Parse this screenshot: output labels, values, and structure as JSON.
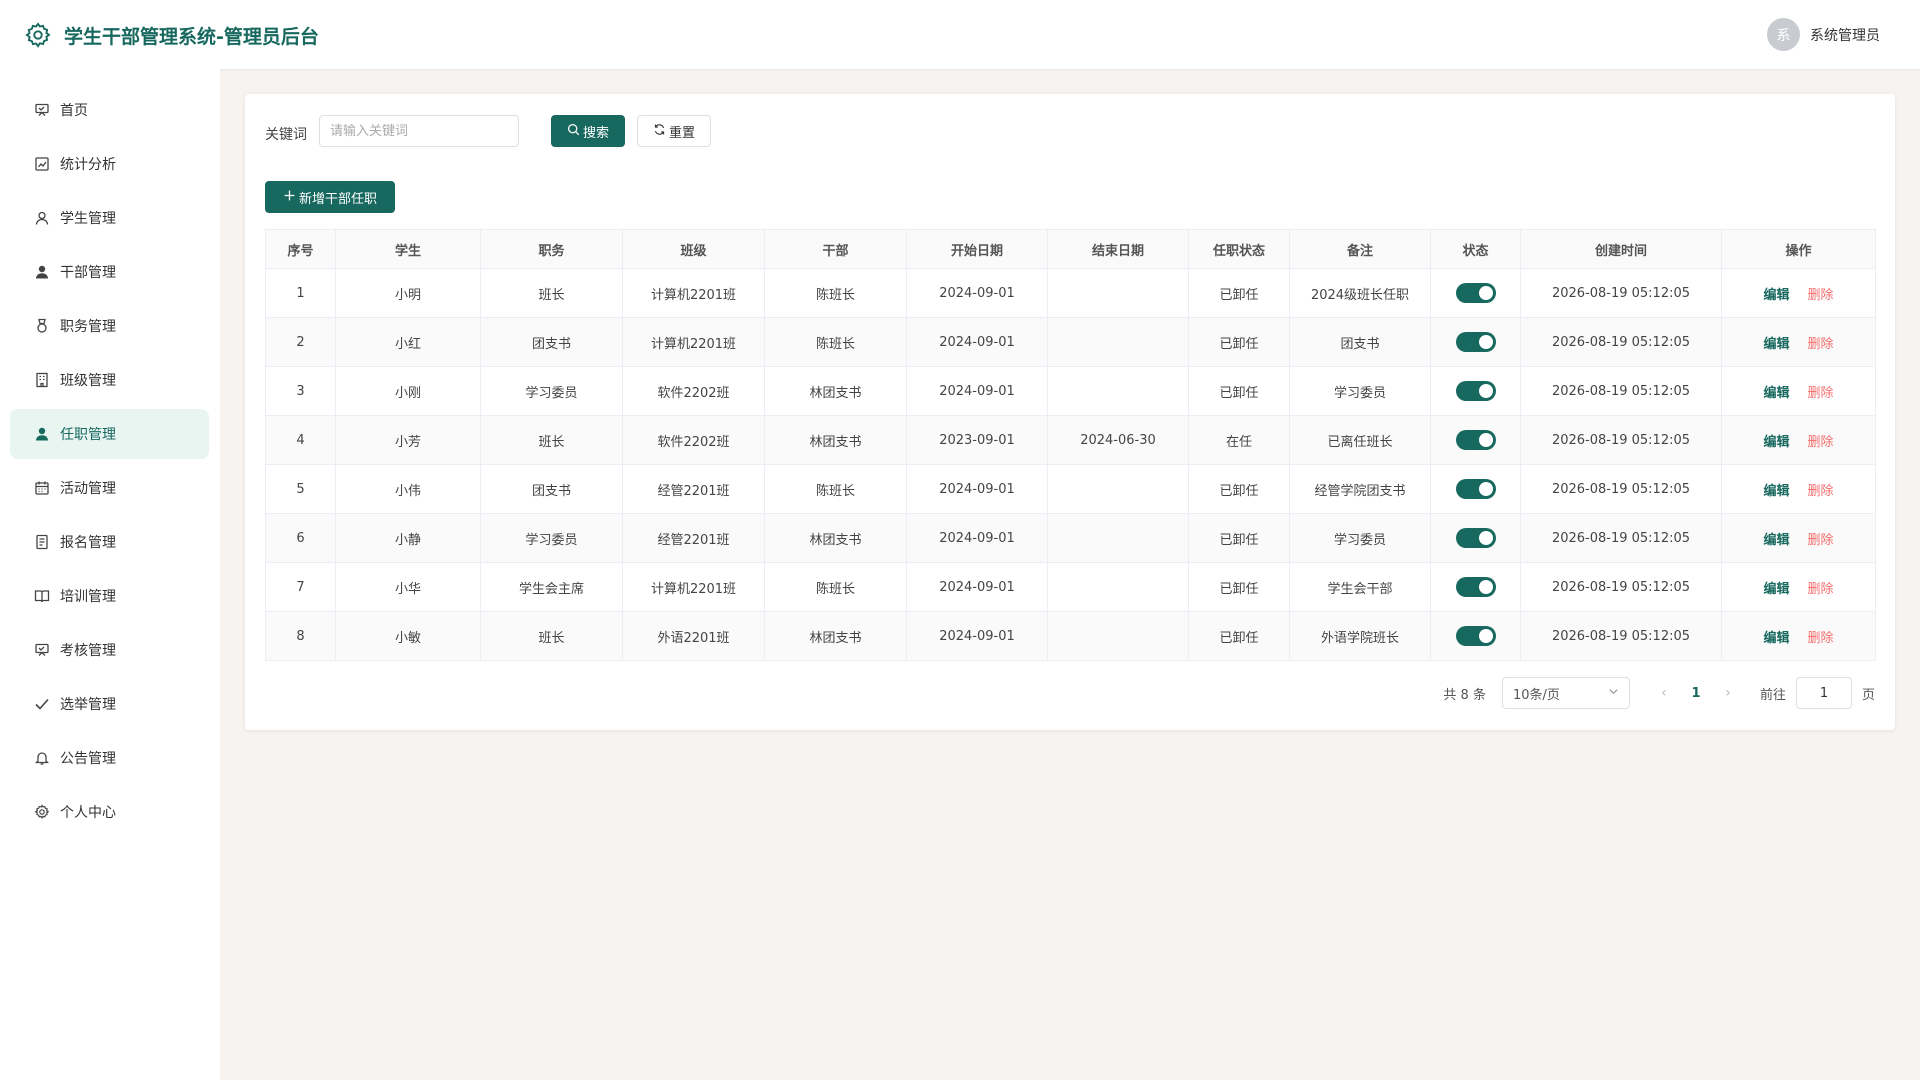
{
  "app": {
    "title": "学生干部管理系统-管理员后台",
    "logo_icon": "gear-icon",
    "brand_color": "#17685e",
    "user_avatar_text": "系",
    "user_name": "系统管理员"
  },
  "sidebar": {
    "items": [
      {
        "label": "首页",
        "icon": "presentation-icon"
      },
      {
        "label": "统计分析",
        "icon": "chart-icon"
      },
      {
        "label": "学生管理",
        "icon": "user-outline-icon"
      },
      {
        "label": "干部管理",
        "icon": "user-filled-icon"
      },
      {
        "label": "职务管理",
        "icon": "medal-icon"
      },
      {
        "label": "班级管理",
        "icon": "building-icon"
      },
      {
        "label": "任职管理",
        "icon": "user-filled-icon",
        "active": true
      },
      {
        "label": "活动管理",
        "icon": "calendar-icon"
      },
      {
        "label": "报名管理",
        "icon": "document-icon"
      },
      {
        "label": "培训管理",
        "icon": "book-icon"
      },
      {
        "label": "考核管理",
        "icon": "presentation-icon"
      },
      {
        "label": "选举管理",
        "icon": "check-icon"
      },
      {
        "label": "公告管理",
        "icon": "bell-icon"
      },
      {
        "label": "个人中心",
        "icon": "gear-icon"
      }
    ]
  },
  "toolbar": {
    "keyword_label": "关键词",
    "keyword_placeholder": "请输入关键词",
    "keyword_value": "",
    "search_label": "搜索",
    "reset_label": "重置",
    "add_label": "新增干部任职"
  },
  "table": {
    "columns": [
      "序号",
      "学生",
      "职务",
      "班级",
      "干部",
      "开始日期",
      "结束日期",
      "任职状态",
      "备注",
      "状态",
      "创建时间",
      "操作"
    ],
    "edit_label": "编辑",
    "delete_label": "删除",
    "rows": [
      {
        "no": "1",
        "student": "小明",
        "position": "班长",
        "class": "计算机2201班",
        "cadre": "陈班长",
        "start": "2024-09-01",
        "end": "",
        "tenure": "已卸任",
        "remark": "2024级班长任职",
        "enabled": true,
        "created": "2026-08-19 05:12:05"
      },
      {
        "no": "2",
        "student": "小红",
        "position": "团支书",
        "class": "计算机2201班",
        "cadre": "陈班长",
        "start": "2024-09-01",
        "end": "",
        "tenure": "已卸任",
        "remark": "团支书",
        "enabled": true,
        "created": "2026-08-19 05:12:05"
      },
      {
        "no": "3",
        "student": "小刚",
        "position": "学习委员",
        "class": "软件2202班",
        "cadre": "林团支书",
        "start": "2024-09-01",
        "end": "",
        "tenure": "已卸任",
        "remark": "学习委员",
        "enabled": true,
        "created": "2026-08-19 05:12:05"
      },
      {
        "no": "4",
        "student": "小芳",
        "position": "班长",
        "class": "软件2202班",
        "cadre": "林团支书",
        "start": "2023-09-01",
        "end": "2024-06-30",
        "tenure": "在任",
        "remark": "已离任班长",
        "enabled": true,
        "created": "2026-08-19 05:12:05"
      },
      {
        "no": "5",
        "student": "小伟",
        "position": "团支书",
        "class": "经管2201班",
        "cadre": "陈班长",
        "start": "2024-09-01",
        "end": "",
        "tenure": "已卸任",
        "remark": "经管学院团支书",
        "enabled": true,
        "created": "2026-08-19 05:12:05"
      },
      {
        "no": "6",
        "student": "小静",
        "position": "学习委员",
        "class": "经管2201班",
        "cadre": "林团支书",
        "start": "2024-09-01",
        "end": "",
        "tenure": "已卸任",
        "remark": "学习委员",
        "enabled": true,
        "created": "2026-08-19 05:12:05"
      },
      {
        "no": "7",
        "student": "小华",
        "position": "学生会主席",
        "class": "计算机2201班",
        "cadre": "陈班长",
        "start": "2024-09-01",
        "end": "",
        "tenure": "已卸任",
        "remark": "学生会干部",
        "enabled": true,
        "created": "2026-08-19 05:12:05"
      },
      {
        "no": "8",
        "student": "小敏",
        "position": "班长",
        "class": "外语2201班",
        "cadre": "林团支书",
        "start": "2024-09-01",
        "end": "",
        "tenure": "已卸任",
        "remark": "外语学院班长",
        "enabled": true,
        "created": "2026-08-19 05:12:05"
      }
    ]
  },
  "pagination": {
    "total_text": "共 8 条",
    "page_size": "10条/页",
    "current_page": "1",
    "goto_label": "前往",
    "goto_value": "1",
    "page_suffix": "页"
  }
}
